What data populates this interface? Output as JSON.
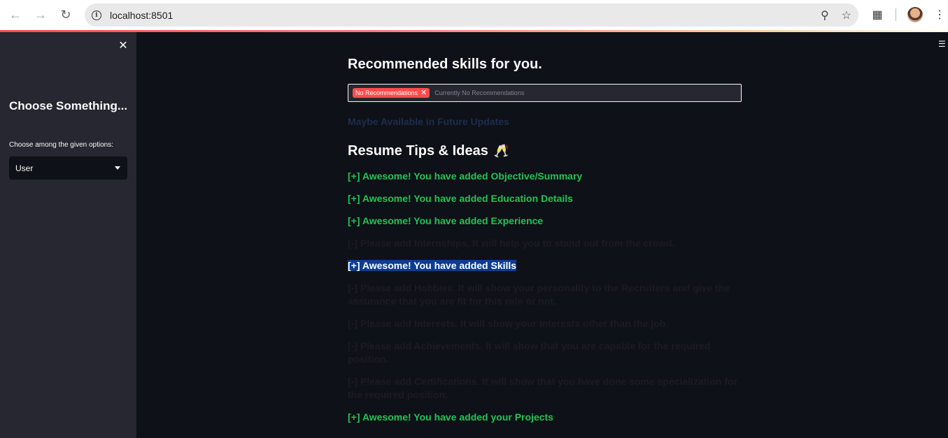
{
  "browser": {
    "url": "localhost:8501"
  },
  "sidebar": {
    "title": "Choose Something...",
    "select_label": "Choose among the given options:",
    "select_value": "User"
  },
  "main": {
    "skills_heading": "Recommended skills for you.",
    "skills_tag": "No Recommendations",
    "skills_placeholder": "Currently No Recommendations",
    "future_note": "Maybe Available in Future Updates",
    "tips_heading": "Resume Tips & Ideas",
    "tips": [
      {
        "text": "[+] Awesome! You have added Objective/Summary",
        "status": "ok"
      },
      {
        "text": "[+] Awesome! You have added Education Details",
        "status": "ok"
      },
      {
        "text": "[+] Awesome! You have added Experience",
        "status": "ok"
      },
      {
        "text": "[-] Please add Internships. It will help you to stand out from the crowd.",
        "status": "missing"
      },
      {
        "text": "[+] Awesome! You have added Skills",
        "status": "selected"
      },
      {
        "text": "[-] Please add Hobbies. It will show your personality to the Recruiters and give the assurance that you are fit for this role or not.",
        "status": "missing"
      },
      {
        "text": "[-] Please add Interests. It will show your interests other than the job.",
        "status": "missing"
      },
      {
        "text": "[-] Please add Achievements. It will show that you are capable for the required position.",
        "status": "missing"
      },
      {
        "text": "[-] Please add Certifications. It will show that you have done some specialization for the required position.",
        "status": "missing"
      },
      {
        "text": "[+] Awesome! You have added your Projects",
        "status": "ok"
      }
    ]
  },
  "colors": {
    "ok": "#21c354",
    "missing": "#1a1c22",
    "tag": "#ff4b4b",
    "highlight": "#0b3d91"
  }
}
